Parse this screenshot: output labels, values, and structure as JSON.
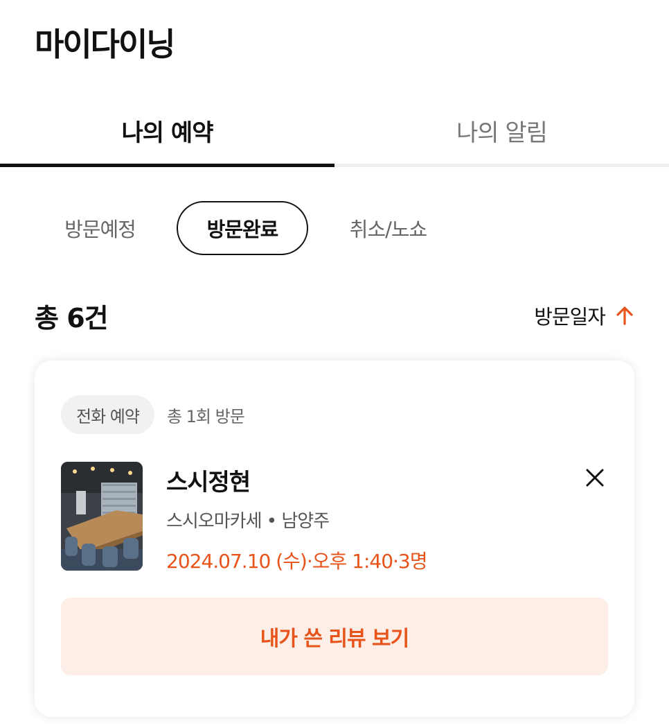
{
  "header": {
    "title": "마이다이닝"
  },
  "tabs": [
    {
      "label": "나의 예약",
      "active": true
    },
    {
      "label": "나의 알림",
      "active": false
    }
  ],
  "filters": [
    {
      "label": "방문예정",
      "selected": false
    },
    {
      "label": "방문완료",
      "selected": true
    },
    {
      "label": "취소/노쇼",
      "selected": false
    }
  ],
  "summary": {
    "total": "총 6건",
    "sort_label": "방문일자",
    "sort_icon": "arrow-up-icon"
  },
  "reservation": {
    "badge": "전화 예약",
    "visit_count": "총 1회 방문",
    "thumbnail_icon": "restaurant-photo",
    "name": "스시정현",
    "meta": "스시오마카세 • 남양주",
    "datetime": "2024.07.10 (수)·오후 1:40·3명",
    "review_button": "내가 쓴 리뷰 보기"
  },
  "colors": {
    "accent": "#e8531a",
    "accent_bg": "#fdeee7",
    "text_primary": "#111111",
    "text_secondary": "#666666"
  }
}
